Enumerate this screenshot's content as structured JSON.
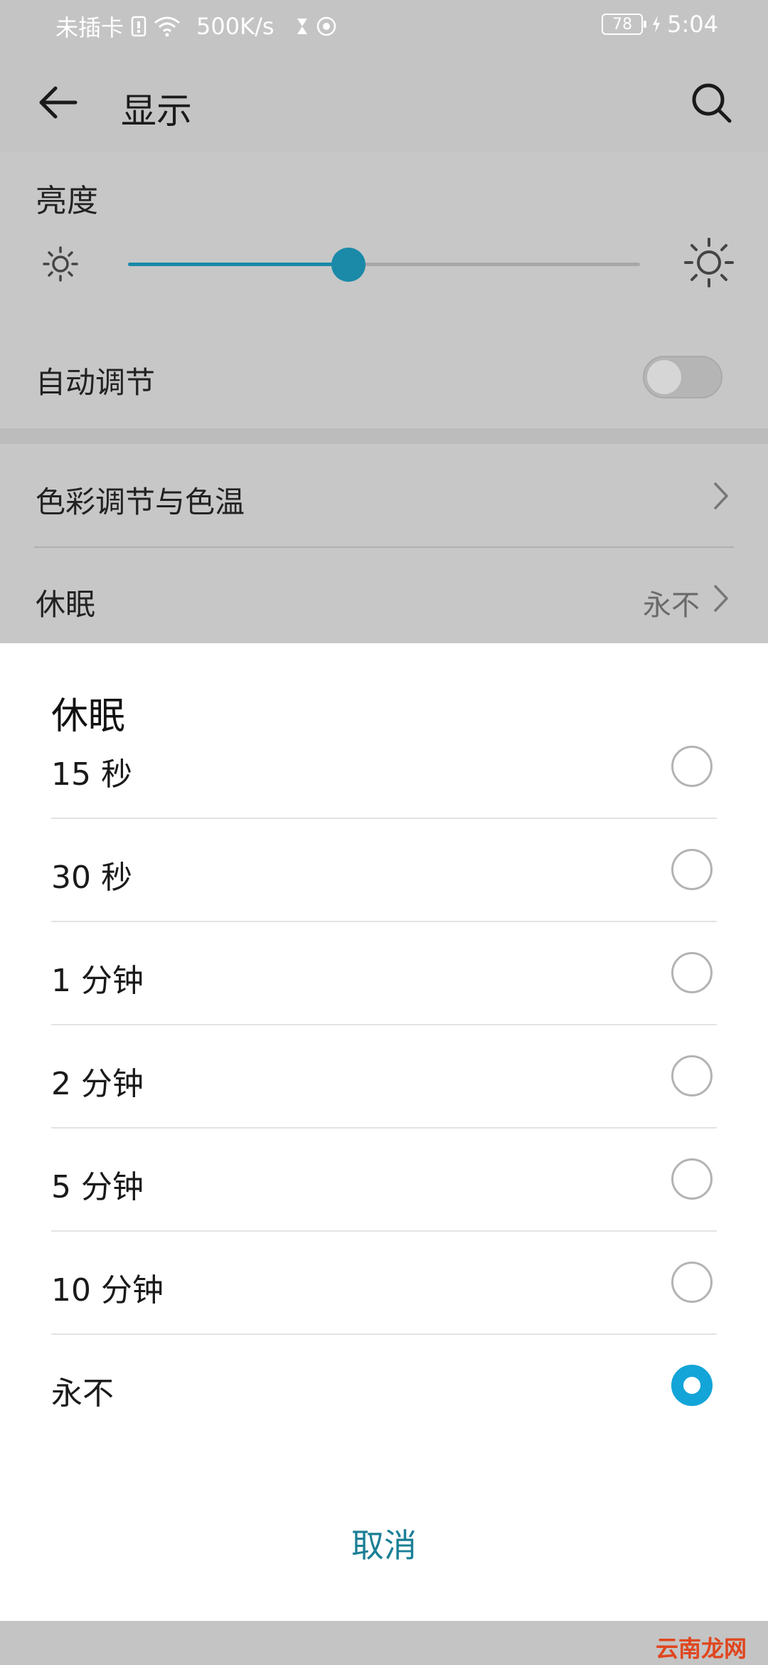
{
  "status_bar": {
    "carrier": "未插卡",
    "speed": "500K/s",
    "battery": "78",
    "time": "5:04"
  },
  "appbar": {
    "title": "显示",
    "back_icon": "arrow-left-icon",
    "search_icon": "search-icon"
  },
  "brightness": {
    "label": "亮度",
    "level": 0.43,
    "auto_label": "自动调节",
    "auto_enabled": false
  },
  "rows": {
    "color": "色彩调节与色温",
    "sleep": "休眠",
    "sleep_value": "永不"
  },
  "dialog": {
    "title": "休眠",
    "options": [
      {
        "label": "15 秒",
        "selected": false
      },
      {
        "label": "30 秒",
        "selected": false
      },
      {
        "label": "1 分钟",
        "selected": false
      },
      {
        "label": "2 分钟",
        "selected": false
      },
      {
        "label": "5 分钟",
        "selected": false
      },
      {
        "label": "10 分钟",
        "selected": false
      },
      {
        "label": "永不",
        "selected": true
      }
    ],
    "cancel_label": "取消"
  },
  "watermark": "云南龙网",
  "colors": {
    "accent": "#13a4d8",
    "slider": "#1a8aa8",
    "cancel": "#1a7f95"
  }
}
